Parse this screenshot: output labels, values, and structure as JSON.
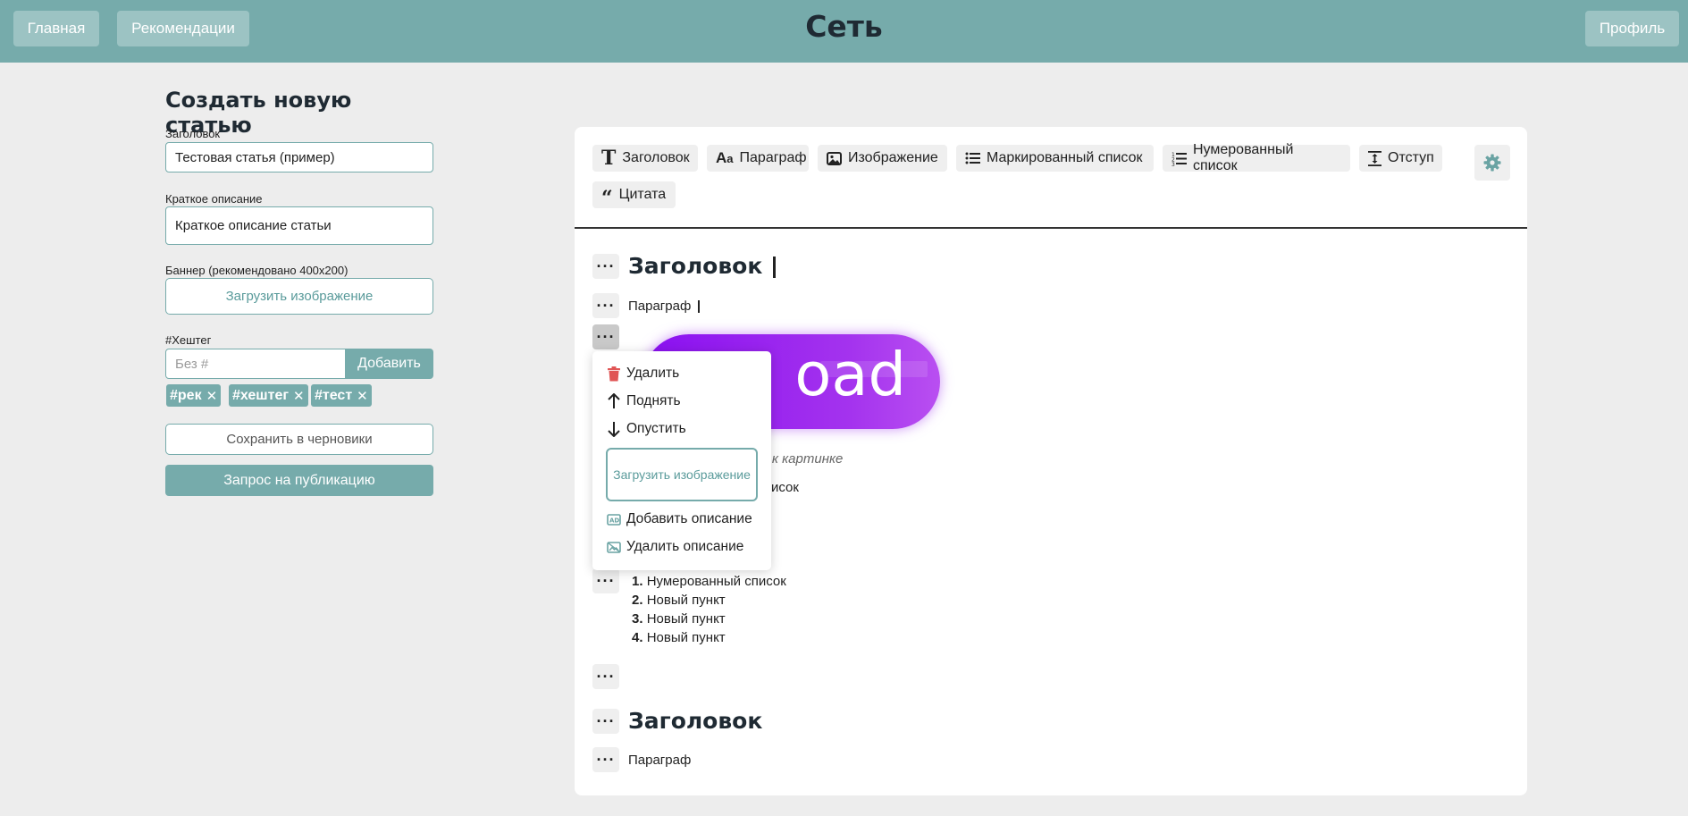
{
  "header": {
    "title": "Сеть",
    "nav_home": "Главная",
    "nav_recs": "Рекомендации",
    "profile": "Профиль"
  },
  "form": {
    "heading": "Создать новую статью",
    "title_label": "Заголовок",
    "title_value": "Тестовая статья (пример)",
    "desc_label": "Краткое описание",
    "desc_value": "Краткое описание статьи",
    "banner_label": "Баннер (рекомендовано 400x200)",
    "banner_button": "Загрузить изображение",
    "hashtag_label": "#Хештег",
    "hashtag_placeholder": "Без #",
    "hashtag_add": "Добавить",
    "tags": [
      "#рек",
      "#хештег",
      "#тест"
    ],
    "save_draft": "Сохранить в черновики",
    "publish": "Запрос на публикацию"
  },
  "toolbar": {
    "heading": "Заголовок",
    "paragraph": "Параграф",
    "image": "Изображение",
    "bullet_list": "Маркированный список",
    "numbered_list": "Нумерованный список",
    "indent": "Отступ",
    "quote": "Цитата"
  },
  "content": {
    "heading1": "Заголовок",
    "paragraph1": "Параграф",
    "image_text": "oad",
    "image_caption": "ие к картинке",
    "bullet_visible": "исок",
    "numbered": [
      {
        "n": "1.",
        "text": "Нумерованный список"
      },
      {
        "n": "2.",
        "text": "Новый пункт"
      },
      {
        "n": "3.",
        "text": "Новый пункт"
      },
      {
        "n": "4.",
        "text": "Новый пункт"
      }
    ],
    "heading2": "Заголовок",
    "paragraph2": "Параграф"
  },
  "menu": {
    "delete": "Удалить",
    "up": "Поднять",
    "down": "Опустить",
    "upload": "Загрузить изображение",
    "add_caption": "Добавить описание",
    "remove_caption": "Удалить описание"
  },
  "colors": {
    "accent": "#76abab",
    "image_gradient_start": "#8a10f0",
    "delete_icon": "#e05555"
  }
}
